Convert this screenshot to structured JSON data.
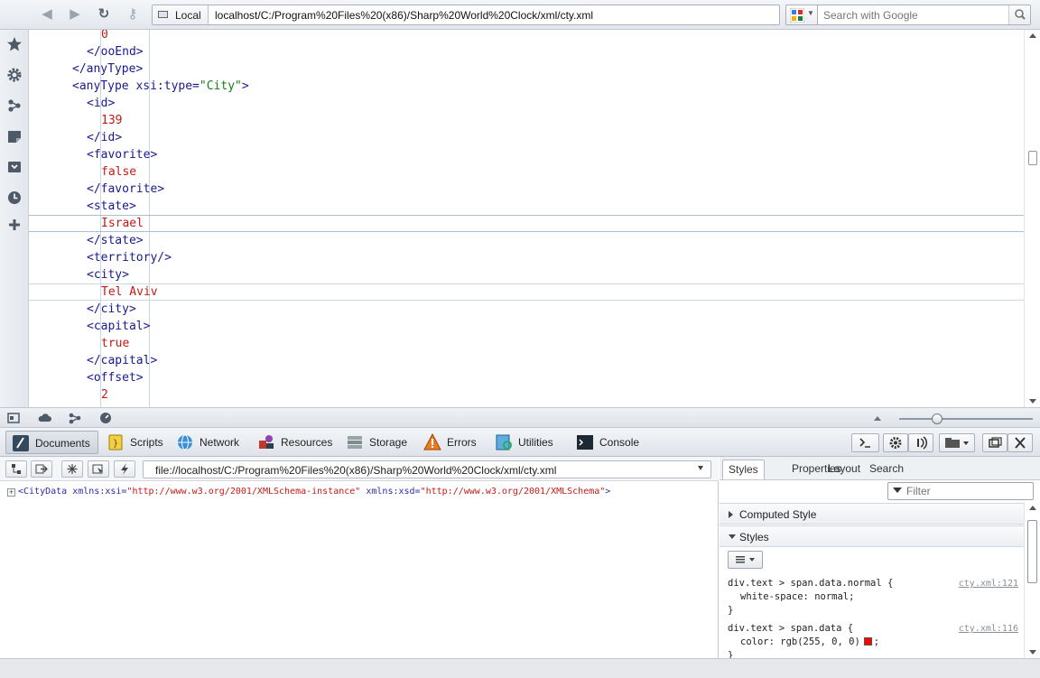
{
  "toolbar": {
    "location_label": "Local",
    "url": "localhost/C:/Program%20Files%20(x86)/Sharp%20World%20Clock/xml/cty.xml",
    "search_placeholder": "Search with Google"
  },
  "sidebar": {
    "items": [
      "bookmarks-icon",
      "settings-icon",
      "unite-icon",
      "notes-icon",
      "downloads-icon",
      "history-icon",
      "add-panel-icon"
    ]
  },
  "xml": {
    "l1": "0",
    "l2": "</ooEnd>",
    "l3": "</anyType>",
    "l4_tag": "<anyType xsi:type=",
    "l4_val": "\"City\"",
    "l4_end": ">",
    "l5": "<id>",
    "l6": "139",
    "l7": "</id>",
    "l8": "<favorite>",
    "l9": "false",
    "l10": "</favorite>",
    "l11": "<state>",
    "l12": "Israel",
    "l13": "</state>",
    "l14": "<territory/>",
    "l15": "<city>",
    "l16": "Tel Aviv",
    "l17": "</city>",
    "l18": "<capital>",
    "l19": "true",
    "l20": "</capital>",
    "l21": "<offset>",
    "l22": "2"
  },
  "devtools": {
    "tabs": [
      "Documents",
      "Scripts",
      "Network",
      "Resources",
      "Storage",
      "Errors",
      "Utilities",
      "Console"
    ],
    "active_tab": "Documents",
    "file_path": "file://localhost/C:/Program%20Files%20(x86)/Sharp%20World%20Clock/xml/cty.xml",
    "dom": {
      "open": "<CityData",
      "attr1": "xmlns:xsi=",
      "val1": "\"http://www.w3.org/2001/XMLSchema-instance\"",
      "attr2": "xmlns:xsd=",
      "val2": "\"http://www.w3.org/2001/XMLSchema\"",
      "close": ">"
    },
    "side_tabs": [
      "Styles",
      "Properties",
      "Layout",
      "Search"
    ],
    "filter_placeholder": "Filter",
    "computed_label": "Computed Style",
    "styles_label": "Styles",
    "rules": [
      {
        "selector": "div.text > span.data.normal {",
        "source": "cty.xml:121",
        "prop": "white-space",
        "value": "normal;"
      },
      {
        "selector": "div.text > span.data {",
        "source": "cty.xml:116",
        "prop": "color",
        "value": "rgb(255, 0, 0)"
      }
    ],
    "rule_close": "}",
    "swatch_color": "#ff0000"
  }
}
